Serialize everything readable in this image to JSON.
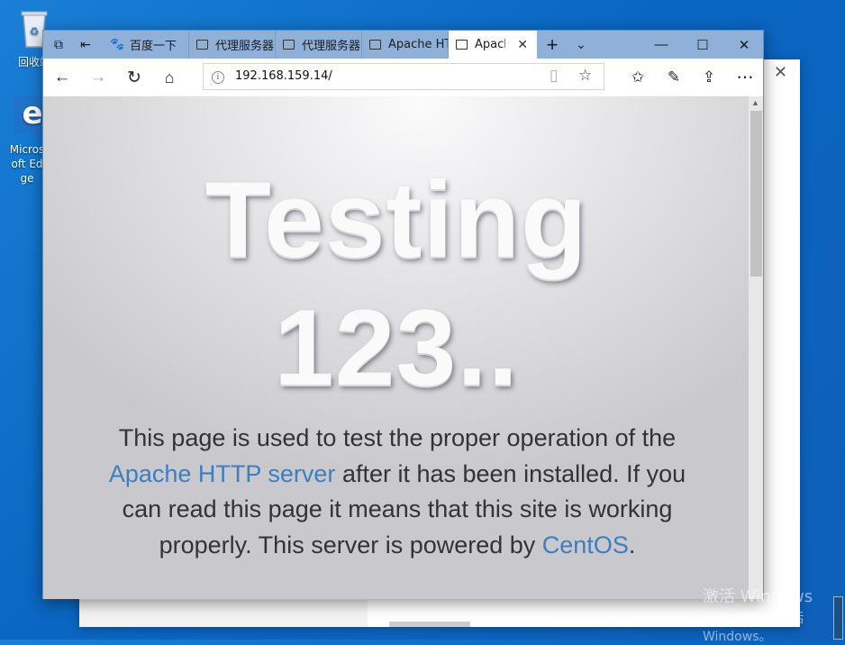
{
  "desktop": {
    "icons": [
      {
        "name": "recycle-bin",
        "label": "回收站"
      },
      {
        "name": "microsoft-edge",
        "label": "Microsoft Edge"
      }
    ]
  },
  "browser": {
    "tabs": [
      {
        "label": "百度一下",
        "icon": "baidu-icon"
      },
      {
        "label": "代理服务器",
        "icon": "page-icon"
      },
      {
        "label": "代理服务器",
        "icon": "page-icon"
      },
      {
        "label": "Apache HTTP",
        "icon": "page-icon"
      },
      {
        "label": "Apache",
        "icon": "page-icon",
        "active": true
      }
    ],
    "new_tab_label": "+",
    "address": "192.168.159.14/"
  },
  "page": {
    "headline_1": "Testing",
    "headline_2": "123..",
    "text_1": "This page is used to test the proper operation of the",
    "link_apache": "Apache HTTP server",
    "text_2": " after it has been installed. If you can read this page it means that this site is working properly. This server is powered by ",
    "link_centos": "CentOS",
    "text_3": ".",
    "link_color": "#3d7ebf"
  },
  "watermark": {
    "line1": "激活 Windows",
    "line2": "转到“设置”以激活 Windows。"
  }
}
